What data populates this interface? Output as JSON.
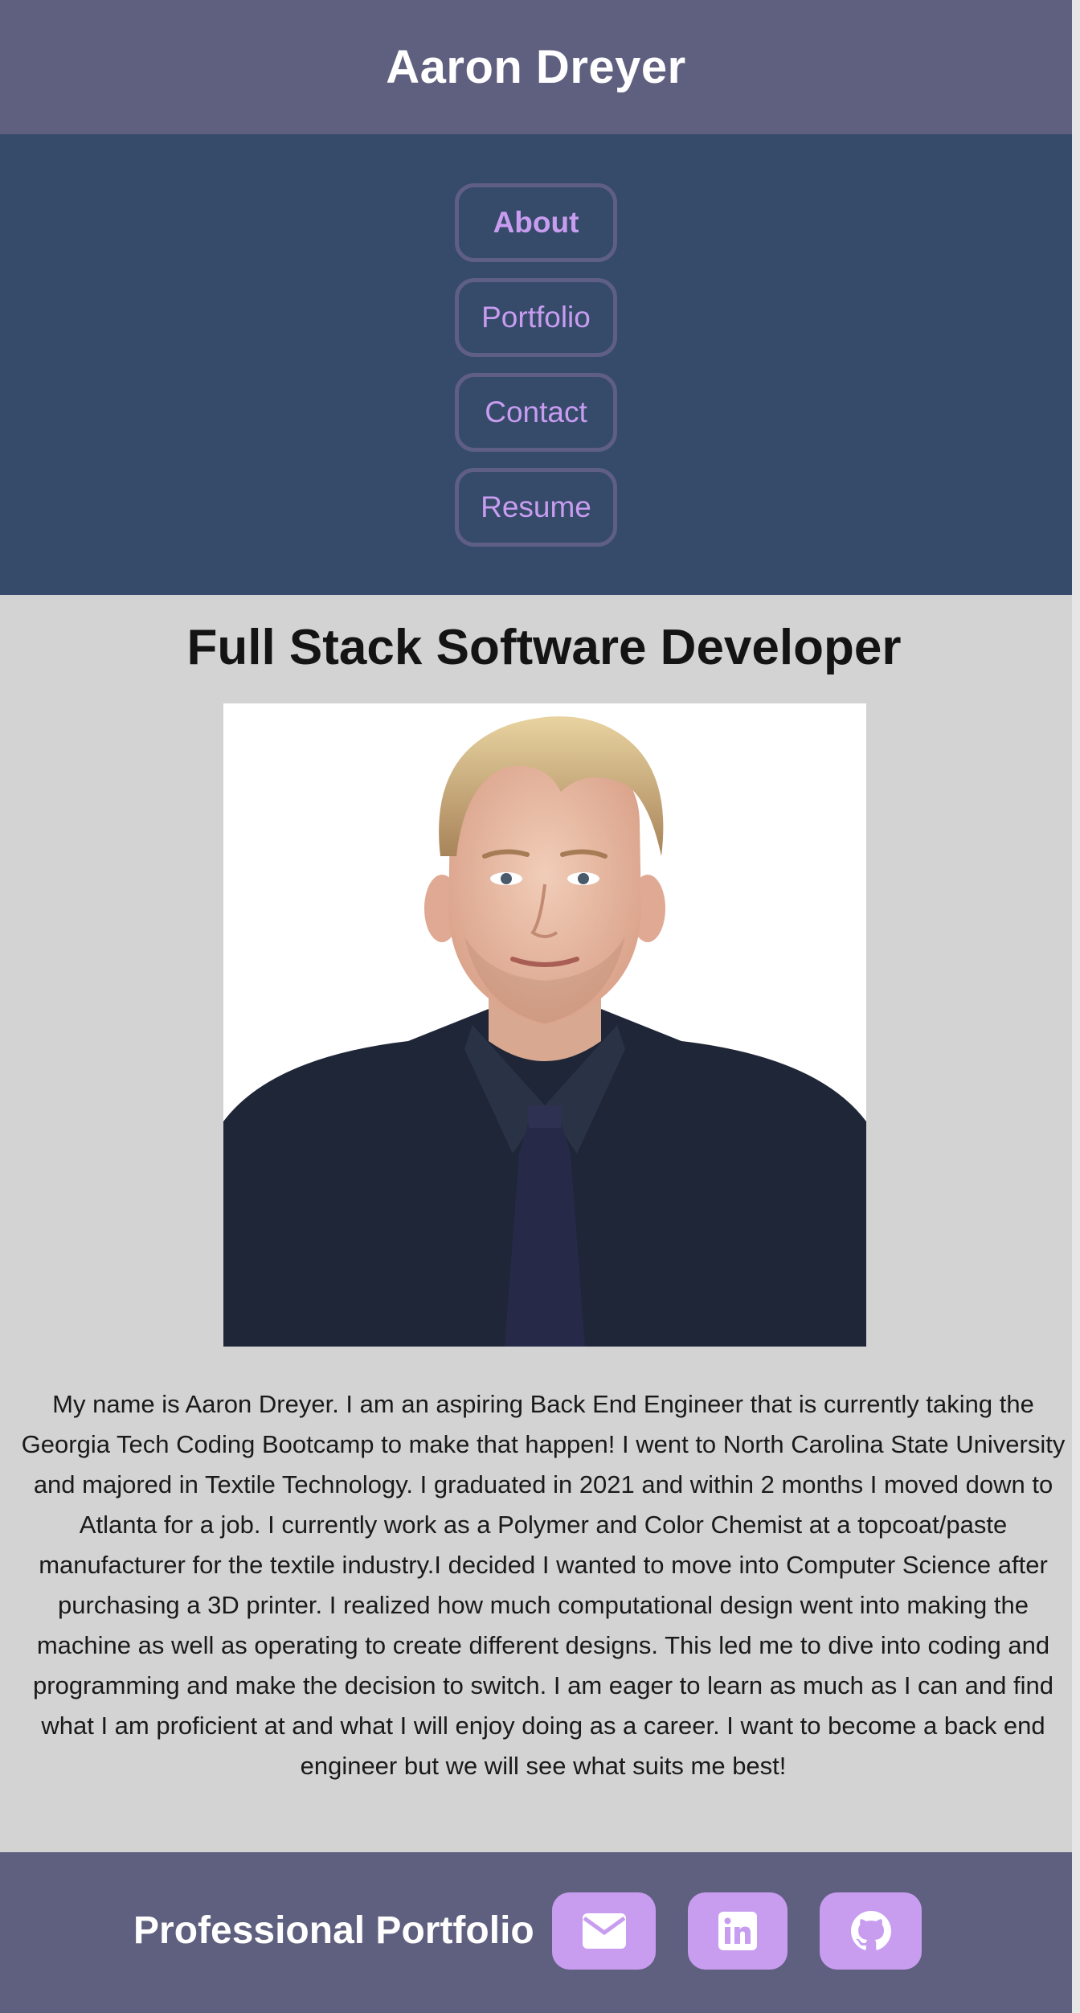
{
  "header": {
    "title": "Aaron Dreyer"
  },
  "nav": {
    "items": [
      {
        "label": "About",
        "active": true
      },
      {
        "label": "Portfolio",
        "active": false
      },
      {
        "label": "Contact",
        "active": false
      },
      {
        "label": "Resume",
        "active": false
      }
    ]
  },
  "about": {
    "heading": "Full Stack Software Developer",
    "portrait_alt": "portrait photo",
    "bio": "My name is Aaron Dreyer. I am an aspiring Back End Engineer that is currently taking the Georgia Tech Coding Bootcamp to make that happen! I went to North Carolina State University and majored in Textile Technology. I graduated in 2021 and within 2 months I moved down to Atlanta for a job. I currently work as a Polymer and Color Chemist at a topcoat/paste manufacturer for the textile industry.I decided I wanted to move into Computer Science after purchasing a 3D printer. I realized how much computational design went into making the machine as well as operating to create different designs. This led me to dive into coding and programming and make the decision to switch. I am eager to learn as much as I can and find what I am proficient at and what I will enjoy doing as a career. I want to become a back end engineer but we will see what suits me best!"
  },
  "footer": {
    "title": "Professional Portfolio",
    "icons": [
      "envelope-icon",
      "linkedin-icon",
      "github-icon"
    ]
  },
  "colors": {
    "header_bg": "#5f5f7f",
    "nav_bg": "#364a6a",
    "accent": "#c89df0",
    "page_bg": "#d3d3d3"
  }
}
